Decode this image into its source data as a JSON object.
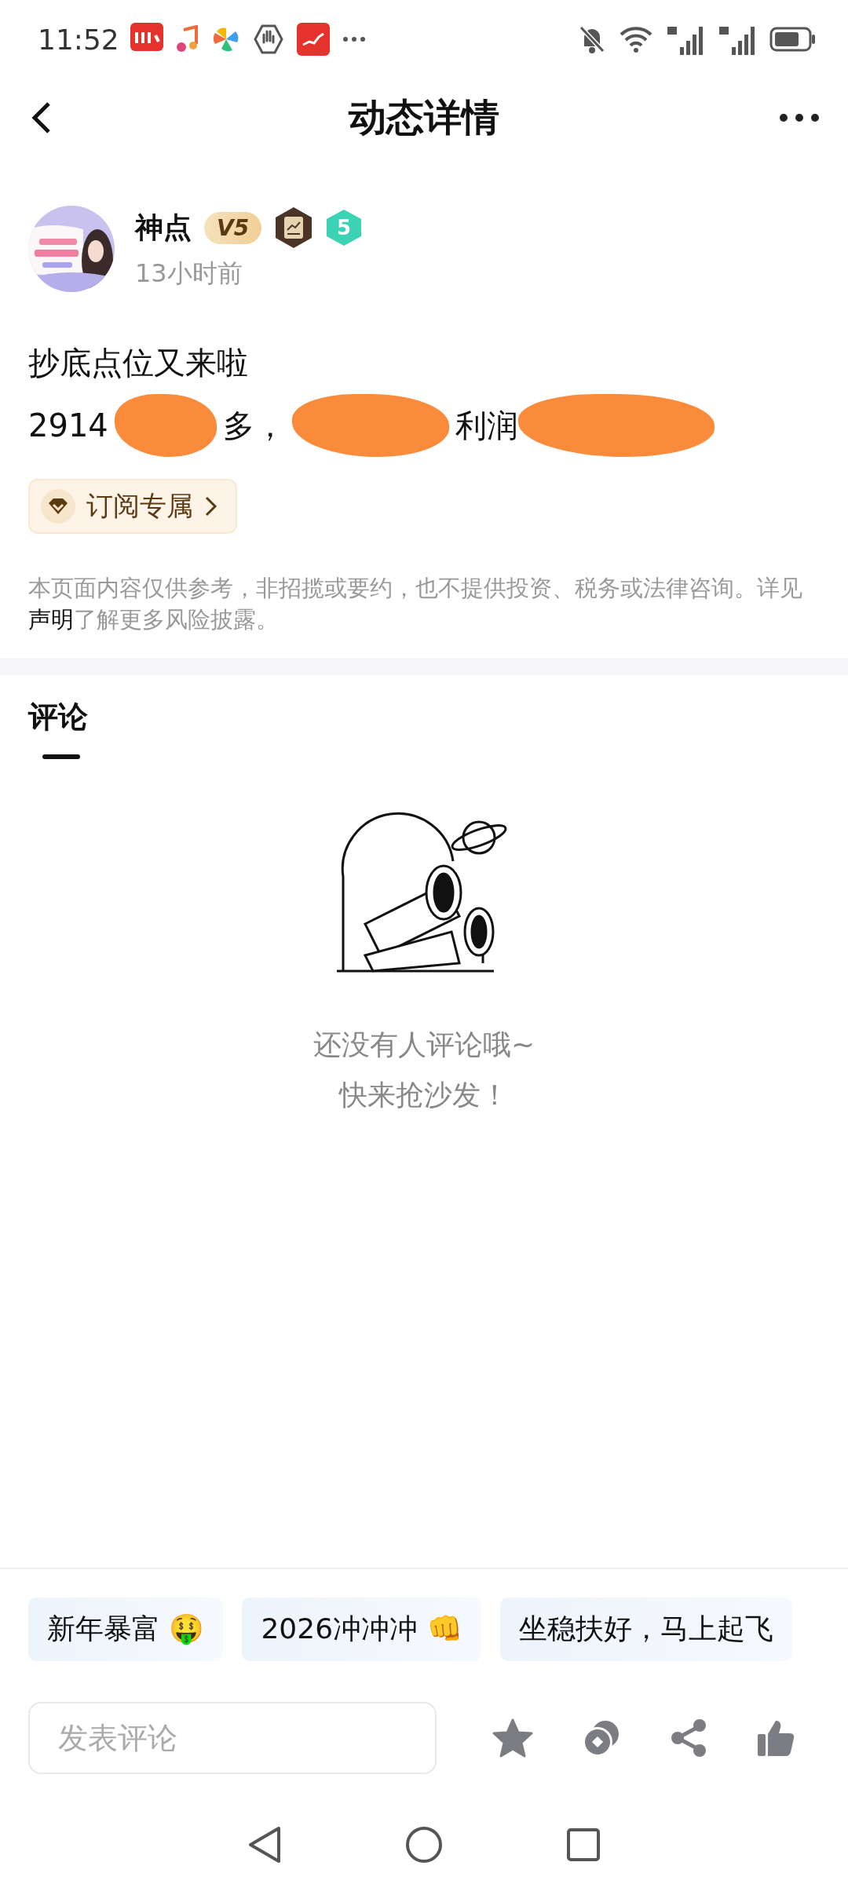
{
  "status_bar": {
    "time": "11:52"
  },
  "header": {
    "title": "动态详情"
  },
  "author": {
    "name": "神点",
    "vip": "V5",
    "level": "5",
    "time": "13小时前"
  },
  "post": {
    "title": "抄底点位又来啦",
    "line": [
      {
        "kind": "text",
        "text": "2914"
      },
      {
        "kind": "redacted"
      },
      {
        "kind": "text",
        "text": "多，"
      },
      {
        "kind": "redacted"
      },
      {
        "kind": "text",
        "text": "利润"
      },
      {
        "kind": "redacted"
      }
    ]
  },
  "subscribe": {
    "label": "订阅专属"
  },
  "disclaimer": {
    "before": "本页面内容仅供参考，非招揽或要约，也不提供投资、税务或法律咨询。详见",
    "link": "声明",
    "after": "了解更多风险披露。"
  },
  "comments": {
    "tab": "评论",
    "empty": [
      "还没有人评论哦~",
      "快来抢沙发！"
    ]
  },
  "quick_replies": [
    "新年暴富 🤑",
    "2026冲冲冲 👊",
    "坐稳扶好，马上起飞"
  ],
  "comment_box": {
    "placeholder": "发表评论"
  }
}
